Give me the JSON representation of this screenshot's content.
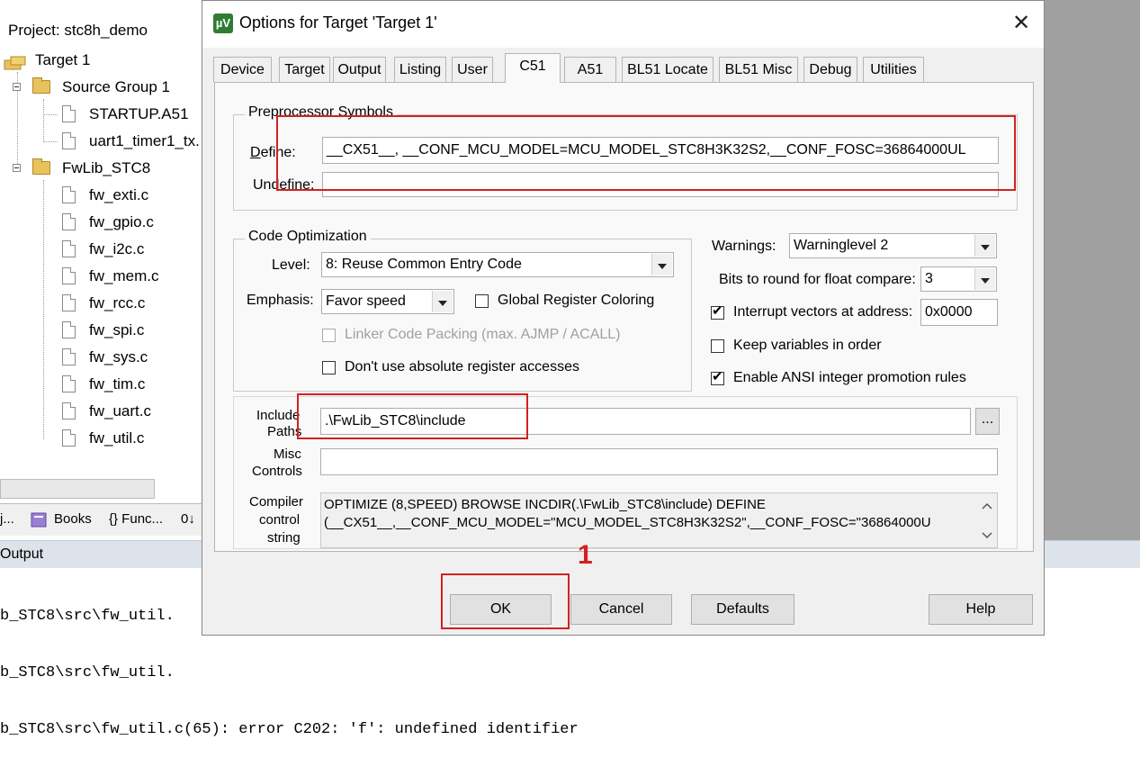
{
  "project": {
    "header": "Project: stc8h_demo",
    "target": "Target 1",
    "group1": "Source Group 1",
    "group1_files": [
      "STARTUP.A51",
      "uart1_timer1_tx."
    ],
    "group2": "FwLib_STC8",
    "group2_files": [
      "fw_exti.c",
      "fw_gpio.c",
      "fw_i2c.c",
      "fw_mem.c",
      "fw_rcc.c",
      "fw_spi.c",
      "fw_sys.c",
      "fw_tim.c",
      "fw_uart.c",
      "fw_util.c"
    ]
  },
  "bottom_tabs": {
    "proj": "j...",
    "books": "Books",
    "funcs": "{} Func...",
    "templ": "0↓"
  },
  "output": {
    "title": "Output",
    "lines": [
      "b_STC8\\src\\fw_util.",
      "b_STC8\\src\\fw_util.",
      "b_STC8\\src\\fw_util.c(65): error C202: 'f': undefined identifier"
    ]
  },
  "dialog": {
    "icon": "µV",
    "title": "Options for Target 'Target 1'",
    "close": "✕",
    "tabs": [
      "Device",
      "Target",
      "Output",
      "Listing",
      "User",
      "C51",
      "A51",
      "BL51 Locate",
      "BL51 Misc",
      "Debug",
      "Utilities"
    ],
    "active_tab": "C51"
  },
  "preprocessor": {
    "title": "Preprocessor Symbols",
    "define_label": "Define:",
    "define_value": "__CX51__, __CONF_MCU_MODEL=MCU_MODEL_STC8H3K32S2,__CONF_FOSC=36864000UL",
    "undefine_label": "Undefine:",
    "undefine_value": ""
  },
  "optimization": {
    "title": "Code Optimization",
    "level_label": "Level:",
    "level_value": "8: Reuse Common Entry Code",
    "emphasis_label": "Emphasis:",
    "emphasis_value": "Favor speed",
    "global_reg_label": "Global Register Coloring",
    "linker_packing_label": "Linker Code Packing (max. AJMP / ACALL)",
    "no_abs_reg_label": "Don't use absolute register accesses"
  },
  "warnings": {
    "label": "Warnings:",
    "value": "Warninglevel 2",
    "bits_label": "Bits to round for float compare:",
    "bits_value": "3",
    "interrupt_label": "Interrupt vectors at address:",
    "interrupt_value": "0x0000",
    "keep_vars_label": "Keep variables in order",
    "ansi_label": "Enable ANSI integer promotion rules"
  },
  "paths": {
    "include_label_1": "Include",
    "include_label_2": "Paths",
    "include_value": ".\\FwLib_STC8\\include",
    "browse": "...",
    "misc_label_1": "Misc",
    "misc_label_2": "Controls",
    "misc_value": "",
    "compiler_label_1": "Compiler",
    "compiler_label_2": "control",
    "compiler_label_3": "string",
    "compiler_line_1": "OPTIMIZE (8,SPEED) BROWSE INCDIR(.\\FwLib_STC8\\include) DEFINE",
    "compiler_line_2": "(__CX51__,__CONF_MCU_MODEL=\"MCU_MODEL_STC8H3K32S2\",__CONF_FOSC=\"36864000U"
  },
  "buttons": {
    "ok": "OK",
    "cancel": "Cancel",
    "defaults": "Defaults",
    "help": "Help"
  },
  "annotation": {
    "step": "1"
  },
  "colors": {
    "highlight": "#d42020",
    "panel": "#f9f9f9",
    "dialog": "#f0f0f0"
  }
}
